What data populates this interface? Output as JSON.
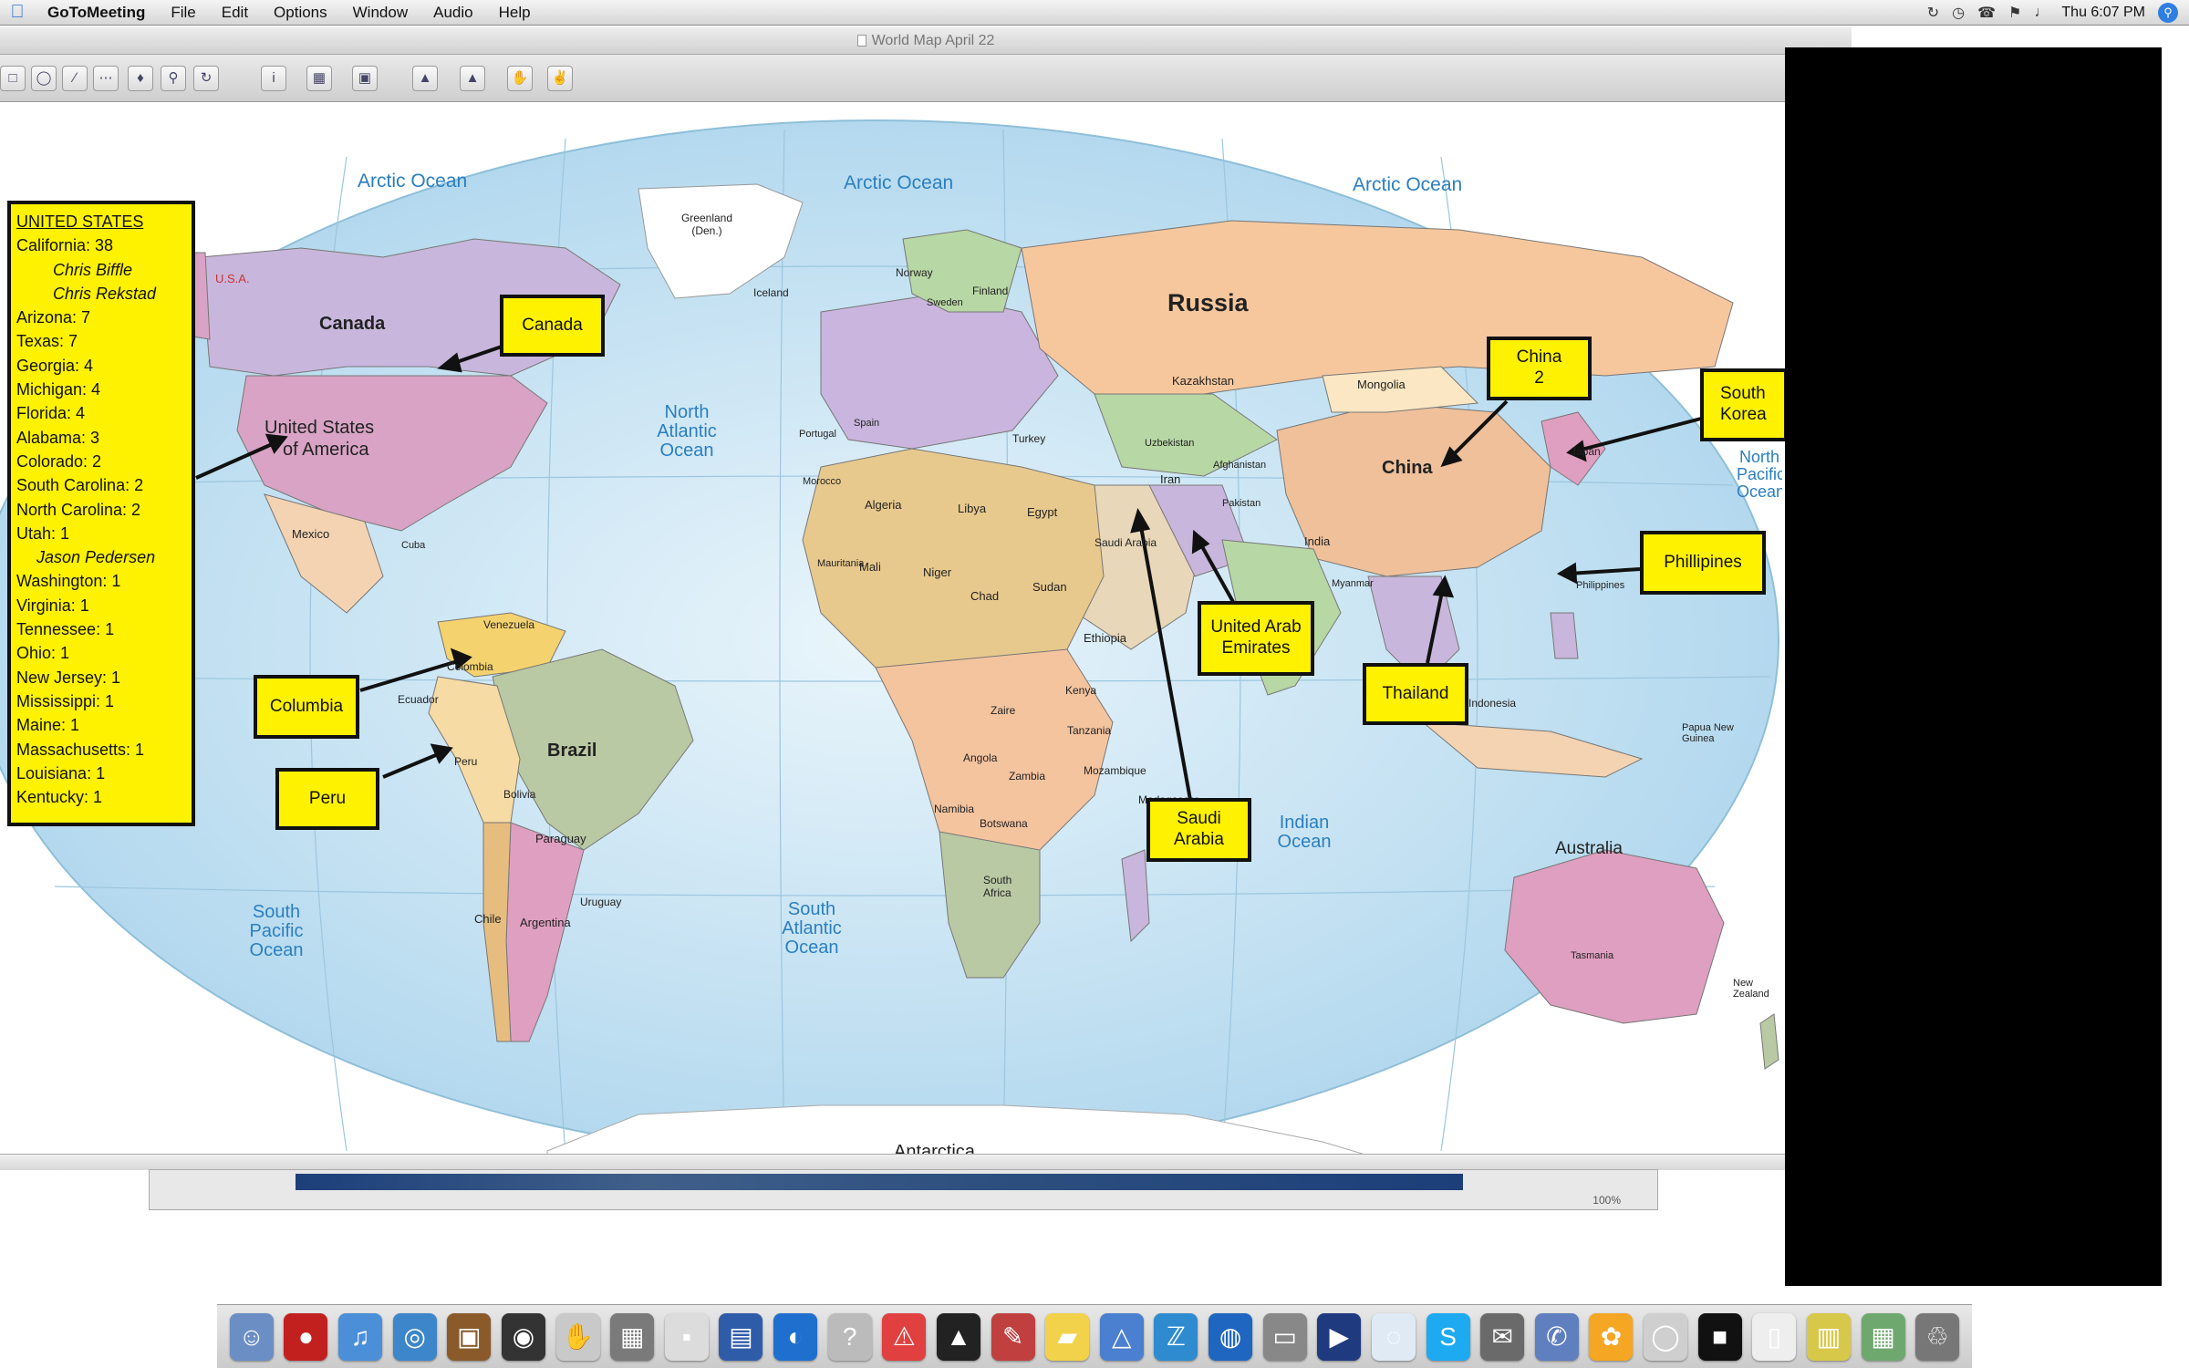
{
  "menubar": {
    "app_name": "GoToMeeting",
    "items": [
      "File",
      "Edit",
      "Options",
      "Window",
      "Audio",
      "Help"
    ],
    "clock": "Thu 6:07 PM"
  },
  "window": {
    "title": "World Map April 22"
  },
  "map": {
    "oceans": {
      "arctic_left": "Arctic Ocean",
      "arctic_mid": "Arctic Ocean",
      "arctic_right": "Arctic Ocean",
      "north_atlantic": "North Atlantic Ocean",
      "south_pacific": "South Pacific Ocean",
      "south_atlantic": "South Atlantic Ocean",
      "indian": "Indian Ocean",
      "north_pacific_right": "North Pacific Ocean",
      "antarctica": "Antarctica"
    },
    "countries": {
      "canada": "Canada",
      "usa_line1": "United States",
      "usa_line2": "of America",
      "usa_small": "U.S.A.",
      "brazil": "Brazil",
      "russia": "Russia",
      "china": "China",
      "australia": "Australia",
      "mexico": "Mexico",
      "greenland": "Greenland (Den.)",
      "kazakhstan": "Kazakhstan",
      "mongolia": "Mongolia",
      "india": "India",
      "iran": "Iran",
      "algeria": "Algeria",
      "libya": "Libya",
      "egypt": "Egypt",
      "sudan": "Sudan",
      "chad": "Chad",
      "niger": "Niger",
      "mali": "Mali",
      "ethiopia": "Ethiopia",
      "argentina": "Argentina",
      "bolivia": "Bolivia",
      "peru_map": "Peru",
      "colombia_map": "Colombia",
      "venezuela": "Venezuela",
      "chile": "Chile",
      "paraguay": "Paraguay",
      "uruguay": "Uruguay",
      "ecuador": "Ecuador",
      "angola": "Angola",
      "zambia": "Zambia",
      "namibia": "Namibia",
      "botswana": "Botswana",
      "south_africa": "South Africa",
      "madagascar": "Madagascar",
      "mozambique": "Mozambique",
      "tanzania": "Tanzania",
      "kenya": "Kenya",
      "zaire": "Zaire",
      "pakistan": "Pakistan",
      "afghanistan": "Afghanistan",
      "turkey": "Turkey",
      "saudi_map": "Saudi Arabia",
      "indonesia": "Indonesia",
      "japan": "Japan",
      "philippines_map": "Philippines",
      "new_zealand": "New Zealand",
      "papua": "Papua New Guinea",
      "morocco": "Morocco",
      "mauritania": "Mauritania",
      "iceland": "Iceland",
      "norway": "Norway",
      "finland": "Finland",
      "sweden": "Sweden",
      "spain": "Spain",
      "portugal": "Portugal",
      "cuba": "Cuba",
      "uzbekistan": "Uzbekistan",
      "myanmar": "Myanmar",
      "tasmania": "Tasmania"
    }
  },
  "us_list": {
    "heading": "UNITED STATES",
    "lines": [
      {
        "text": "California: 38",
        "style": "normal"
      },
      {
        "text": "Chris Biffle",
        "style": "it2"
      },
      {
        "text": "Chris Rekstad",
        "style": "it2"
      },
      {
        "text": "Arizona: 7",
        "style": "normal"
      },
      {
        "text": "Texas: 7",
        "style": "normal"
      },
      {
        "text": "Georgia: 4",
        "style": "normal"
      },
      {
        "text": "Michigan: 4",
        "style": "normal"
      },
      {
        "text": "Florida: 4",
        "style": "normal"
      },
      {
        "text": "Alabama: 3",
        "style": "normal"
      },
      {
        "text": "Colorado: 2",
        "style": "normal"
      },
      {
        "text": "South Carolina: 2",
        "style": "normal"
      },
      {
        "text": "North Carolina: 2",
        "style": "normal"
      },
      {
        "text": "Utah: 1",
        "style": "normal"
      },
      {
        "text": "Jason Pedersen",
        "style": "it"
      },
      {
        "text": "Washington: 1",
        "style": "normal"
      },
      {
        "text": "Virginia: 1",
        "style": "normal"
      },
      {
        "text": "Tennessee: 1",
        "style": "normal"
      },
      {
        "text": "Ohio: 1",
        "style": "normal"
      },
      {
        "text": "New Jersey: 1",
        "style": "normal"
      },
      {
        "text": "Mississippi: 1",
        "style": "normal"
      },
      {
        "text": "Maine: 1",
        "style": "normal"
      },
      {
        "text": "Massachusetts: 1",
        "style": "normal"
      },
      {
        "text": "Louisiana: 1",
        "style": "normal"
      },
      {
        "text": "Kentucky: 1",
        "style": "normal"
      }
    ]
  },
  "callouts": {
    "canada": "Canada",
    "columbia": "Columbia",
    "peru": "Peru",
    "uae_line1": "United Arab",
    "uae_line2": "Emirates",
    "saudi_line1": "Saudi",
    "saudi_line2": "Arabia",
    "china_line1": "China",
    "china_line2": "2",
    "south_korea_line1": "South",
    "south_korea_line2": "Korea",
    "philippines": "Phillipines",
    "thailand": "Thailand"
  },
  "scroll": {
    "zoom_value": "100%"
  },
  "colors": {
    "callout_fill": "#fff200",
    "ocean": "#cfe8f5",
    "russia": "#f6c79d",
    "usa": "#d8a3c4",
    "canada": "#c8b6dc",
    "brazil": "#b9c9a3",
    "china": "#efc09a",
    "australia": "#df9fc0",
    "redaction": "#000000"
  },
  "dock": {
    "icons": [
      "finder-icon",
      "browser-icon",
      "itunes-icon",
      "safari-icon",
      "photo-icon",
      "dvd-icon",
      "preview-icon",
      "calculator-icon",
      "app-icon",
      "mail-icon",
      "system-icon",
      "help-icon",
      "pdf-icon",
      "app-icon",
      "pencil-icon",
      "stickies-icon",
      "app-icon",
      "app-icon",
      "globe-icon",
      "app-icon",
      "imovie-icon",
      "chat-icon",
      "skype-icon",
      "app-icon",
      "app-icon",
      "flower-icon",
      "photos-icon",
      "trash-icon",
      "app-icon",
      "app-icon",
      "app-icon",
      "trash-icon"
    ]
  }
}
